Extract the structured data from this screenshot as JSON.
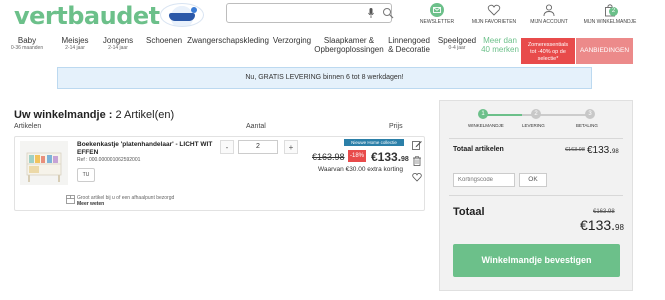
{
  "brand": {
    "logo": "vertbaudet"
  },
  "search": {
    "placeholder": ""
  },
  "header_icons": {
    "newsletter": "NEWSLETTER",
    "favorites": "MIJN FAVORIETEN",
    "account": "MIJN ACCOUNT",
    "cart": "MIJN WINKELMANDJE",
    "cart_count": "2"
  },
  "nav": {
    "items": [
      {
        "label": "Baby",
        "sub": "0-36 maanden"
      },
      {
        "label": "Meisjes",
        "sub": "2-14 jaar"
      },
      {
        "label": "Jongens",
        "sub": "2-14 jaar"
      },
      {
        "label": "Schoenen",
        "sub": ""
      },
      {
        "label": "Zwangerschapskleding",
        "sub": ""
      },
      {
        "label": "Verzorging",
        "sub": ""
      },
      {
        "label": "Slaapkamer &",
        "sub": "",
        "line2": "Opbergoplossingen"
      },
      {
        "label": "Linnengoed",
        "sub": "",
        "line2": "& Decoratie"
      },
      {
        "label": "Speelgoed",
        "sub": "0-4 jaar"
      }
    ],
    "green": {
      "line1": "Meer dan",
      "line2": "40 merken"
    },
    "promo": {
      "line1": "Zomeressentials",
      "line2": "tot -40% op de",
      "line3": "selectie*"
    },
    "offers": "AANBIEDINGEN"
  },
  "banner": "Nu, GRATIS LEVERING binnen 6 tot 8 werkdagen!",
  "cart": {
    "title_bold": "Uw winkelmandje :",
    "title_count": " 2 Artikel(en)",
    "col_items": "Artikelen",
    "col_qty": "Aantal",
    "col_price": "Prijs",
    "item": {
      "name": "Boekenkastje 'platenhandelaar' - LICHT WIT EFFEN",
      "ref": "Ref : 000.000001062592001",
      "size": "TU",
      "qty_minus": "-",
      "qty": "2",
      "qty_plus": "+",
      "tag": "Nieuwe Home collectie",
      "old_price": "€163.98",
      "discount": "-18%",
      "new_price_main": "€133.",
      "new_price_cents": "98",
      "saving": "Waarvan €30.00 extra korting",
      "pickup_line1": "Groot artikel bij u of een afhaalpunt bezorgd",
      "pickup_link": "Meer weten"
    }
  },
  "summary": {
    "steps": [
      {
        "num": "1",
        "label": "WINKELMANDJE"
      },
      {
        "num": "2",
        "label": "LEVERING"
      },
      {
        "num": "3",
        "label": "BETALING"
      }
    ],
    "total_items_label": "Totaal artikelen",
    "total_items_old": "€163.98",
    "total_items_new_main": "€133.",
    "total_items_new_cents": "98",
    "promo_placeholder": "Kortingscode",
    "promo_button": "OK",
    "total_label": "Totaal",
    "total_old": "€163.98",
    "total_new_main": "€133.",
    "total_new_cents": "98",
    "confirm_button": "Winkelmandje bevestigen"
  },
  "colors": {
    "brand_green": "#6cc08a",
    "promo_red": "#e84b4b",
    "banner_blue": "#e5f1fb",
    "tag_blue": "#2b7fa8"
  }
}
